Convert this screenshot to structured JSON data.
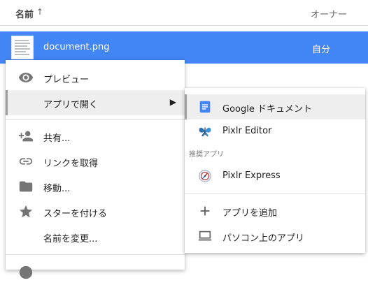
{
  "header": {
    "name_col": "名前",
    "sort_icon": "arrow-up-icon",
    "owner_col": "オーナー"
  },
  "file": {
    "name": "document.png",
    "owner": "自分"
  },
  "context_menu": {
    "items": [
      {
        "label": "プレビュー",
        "icon": "eye-icon"
      },
      {
        "label": "アプリで開く",
        "icon": "",
        "submenu": true
      },
      {
        "label": "共有...",
        "icon": "person-add-icon"
      },
      {
        "label": "リンクを取得",
        "icon": "link-icon"
      },
      {
        "label": "移動...",
        "icon": "folder-icon"
      },
      {
        "label": "スターを付ける",
        "icon": "star-icon"
      },
      {
        "label": "名前を変更...",
        "icon": ""
      }
    ]
  },
  "open_with_menu": {
    "apps": [
      {
        "label": "Google ドキュメント",
        "icon": "google-docs-icon"
      },
      {
        "label": "Pixlr Editor",
        "icon": "pixlr-editor-icon"
      }
    ],
    "recommended_label": "推奨アプリ",
    "recommended": [
      {
        "label": "Pixlr Express",
        "icon": "pixlr-express-icon"
      }
    ],
    "actions": [
      {
        "label": "アプリを追加",
        "icon": "plus-icon"
      },
      {
        "label": "パソコン上のアプリ",
        "icon": "laptop-icon"
      }
    ]
  },
  "colors": {
    "selection": "#4285f4",
    "docs_blue": "#4285f4",
    "icon_gray": "#757575"
  }
}
